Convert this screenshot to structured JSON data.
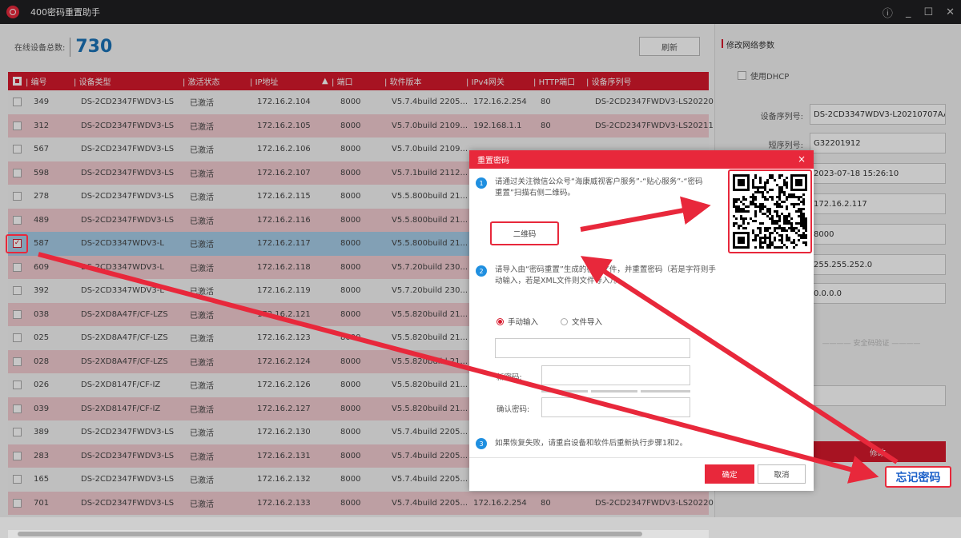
{
  "app": {
    "title": "400密码重置助手"
  },
  "window_controls": {
    "help": "ⓘ",
    "minimize": "_",
    "maximize": "☐",
    "close": "✕"
  },
  "stats": {
    "label": "在线设备总数:",
    "count": "730"
  },
  "toolbar": {
    "refresh_label": "刷新"
  },
  "table": {
    "headers": [
      "编号",
      "设备类型",
      "激活状态",
      "IP地址",
      "端口",
      "软件版本",
      "IPv4网关",
      "HTTP端口",
      "设备序列号"
    ],
    "sort_indicator": "▲",
    "rows": [
      {
        "id": "349",
        "type": "DS-2CD2347FWDV3-LS",
        "status": "已激活",
        "ip": "172.16.2.104",
        "port": "8000",
        "version": "V5.7.4build 2205...",
        "gateway": "172.16.2.254",
        "http": "80",
        "serial": "DS-2CD2347FWDV3-LS20220"
      },
      {
        "id": "312",
        "type": "DS-2CD2347FWDV3-LS",
        "status": "已激活",
        "ip": "172.16.2.105",
        "port": "8000",
        "version": "V5.7.0build 2109...",
        "gateway": "192.168.1.1",
        "http": "80",
        "serial": "DS-2CD2347FWDV3-LS20211"
      },
      {
        "id": "567",
        "type": "DS-2CD2347FWDV3-LS",
        "status": "已激活",
        "ip": "172.16.2.106",
        "port": "8000",
        "version": "V5.7.0build 2109...",
        "gateway": "",
        "http": "",
        "serial": ""
      },
      {
        "id": "598",
        "type": "DS-2CD2347FWDV3-LS",
        "status": "已激活",
        "ip": "172.16.2.107",
        "port": "8000",
        "version": "V5.7.1build 2112...",
        "gateway": "",
        "http": "",
        "serial": ""
      },
      {
        "id": "278",
        "type": "DS-2CD2347FWDV3-LS",
        "status": "已激活",
        "ip": "172.16.2.115",
        "port": "8000",
        "version": "V5.5.800build 21...",
        "gateway": "",
        "http": "",
        "serial": ""
      },
      {
        "id": "489",
        "type": "DS-2CD2347FWDV3-LS",
        "status": "已激活",
        "ip": "172.16.2.116",
        "port": "8000",
        "version": "V5.5.800build 21...",
        "gateway": "",
        "http": "",
        "serial": ""
      },
      {
        "id": "587",
        "type": "DS-2CD3347WDV3-L",
        "status": "已激活",
        "ip": "172.16.2.117",
        "port": "8000",
        "version": "V5.5.800build 21...",
        "gateway": "",
        "http": "",
        "serial": ""
      },
      {
        "id": "609",
        "type": "DS-2CD3347WDV3-L",
        "status": "已激活",
        "ip": "172.16.2.118",
        "port": "8000",
        "version": "V5.7.20build 230...",
        "gateway": "",
        "http": "",
        "serial": ""
      },
      {
        "id": "392",
        "type": "DS-2CD3347WDV3-L",
        "status": "已激活",
        "ip": "172.16.2.119",
        "port": "8000",
        "version": "V5.7.20build 230...",
        "gateway": "",
        "http": "",
        "serial": ""
      },
      {
        "id": "038",
        "type": "DS-2XD8A47F/CF-LZS",
        "status": "已激活",
        "ip": "172.16.2.121",
        "port": "8000",
        "version": "V5.5.820build 21...",
        "gateway": "",
        "http": "",
        "serial": ""
      },
      {
        "id": "025",
        "type": "DS-2XD8A47F/CF-LZS",
        "status": "已激活",
        "ip": "172.16.2.123",
        "port": "8000",
        "version": "V5.5.820build 21...",
        "gateway": "",
        "http": "",
        "serial": ""
      },
      {
        "id": "028",
        "type": "DS-2XD8A47F/CF-LZS",
        "status": "已激活",
        "ip": "172.16.2.124",
        "port": "8000",
        "version": "V5.5.820build 21...",
        "gateway": "",
        "http": "",
        "serial": ""
      },
      {
        "id": "026",
        "type": "DS-2XD8147F/CF-IZ",
        "status": "已激活",
        "ip": "172.16.2.126",
        "port": "8000",
        "version": "V5.5.820build 21...",
        "gateway": "",
        "http": "",
        "serial": ""
      },
      {
        "id": "039",
        "type": "DS-2XD8147F/CF-IZ",
        "status": "已激活",
        "ip": "172.16.2.127",
        "port": "8000",
        "version": "V5.5.820build 21...",
        "gateway": "",
        "http": "",
        "serial": ""
      },
      {
        "id": "389",
        "type": "DS-2CD2347FWDV3-LS",
        "status": "已激活",
        "ip": "172.16.2.130",
        "port": "8000",
        "version": "V5.7.4build 2205...",
        "gateway": "",
        "http": "",
        "serial": ""
      },
      {
        "id": "283",
        "type": "DS-2CD2347FWDV3-LS",
        "status": "已激活",
        "ip": "172.16.2.131",
        "port": "8000",
        "version": "V5.7.4build 2205...",
        "gateway": "",
        "http": "",
        "serial": ""
      },
      {
        "id": "165",
        "type": "DS-2CD2347FWDV3-LS",
        "status": "已激活",
        "ip": "172.16.2.132",
        "port": "8000",
        "version": "V5.7.4build 2205...",
        "gateway": "",
        "http": "",
        "serial": ""
      },
      {
        "id": "701",
        "type": "DS-2CD2347FWDV3-LS",
        "status": "已激活",
        "ip": "172.16.2.133",
        "port": "8000",
        "version": "V5.7.4build 2205...",
        "gateway": "172.16.2.254",
        "http": "80",
        "serial": "DS-2CD2347FWDV3-LS20220"
      }
    ]
  },
  "right_panel": {
    "title": "修改网络参数",
    "dhcp_label": "使用DHCP",
    "fields": [
      {
        "label": "设备序列号:",
        "value": "DS-2CD3347WDV3-L20210707AAC"
      },
      {
        "label": "短序列号:",
        "value": "G32201912"
      },
      {
        "label": "",
        "value": "2023-07-18 15:26:10"
      },
      {
        "label": "",
        "value": "172.16.2.117"
      },
      {
        "label": "",
        "value": "8000"
      },
      {
        "label": "",
        "value": "255.255.252.0"
      },
      {
        "label": "",
        "value": "0.0.0.0"
      }
    ],
    "safe_verify_label": "安全码验证",
    "modify_label": "修改"
  },
  "dialog": {
    "title": "重置密码",
    "close": "×",
    "step1_num": "1",
    "step1_text": "请通过关注微信公众号“海康威视客户服务”-“贴心服务”-“密码重置”扫描右侧二维码。",
    "qr_button_label": "二维码",
    "step2_num": "2",
    "step2_text": "请导入由“密码重置”生成的密钥文件，并重置密码（若是字符则手动输入，若是XML文件则文件导入）。",
    "radio_manual": "手动输入",
    "radio_file": "文件导入",
    "new_password_label": "新密码:",
    "confirm_password_label": "确认密码:",
    "step3_num": "3",
    "step3_text": "如果恢复失败，请重启设备和软件后重新执行步骤1和2。",
    "ok_label": "确定",
    "cancel_label": "取消"
  },
  "annotation": {
    "forgot_password_label": "忘记密码",
    "accent_color": "#e8283b",
    "link_color": "#1a5fc8"
  }
}
